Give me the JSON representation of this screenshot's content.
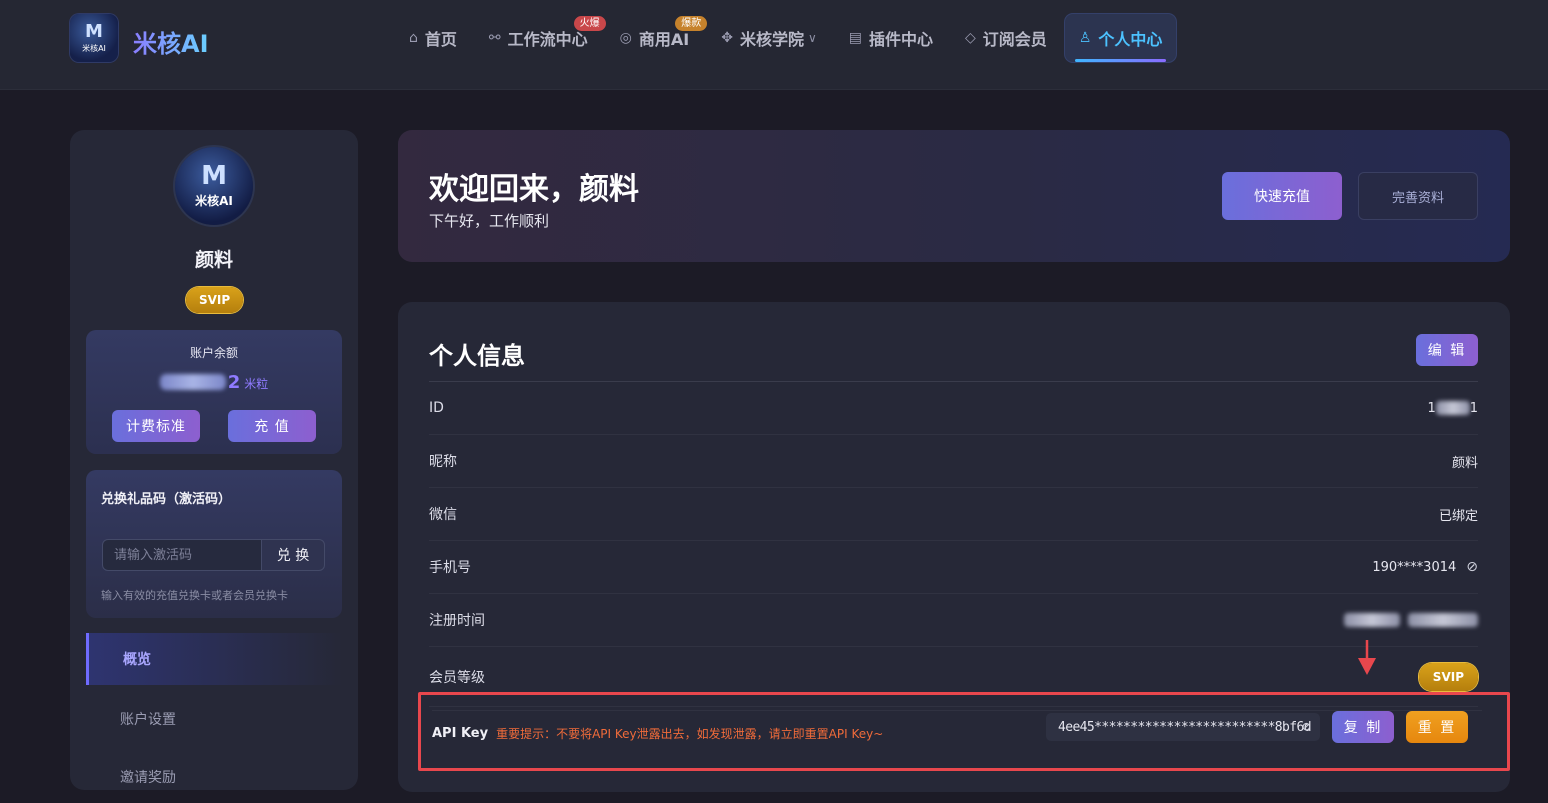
{
  "header": {
    "logo_text_m": "M",
    "logo_text_sub": "米核AI",
    "brand": "米核AI",
    "nav": [
      {
        "label": "首页",
        "icon": "⌂",
        "icon_name": "home-icon"
      },
      {
        "label": "工作流中心",
        "icon": "⚯",
        "icon_name": "workflow-icon",
        "badge": "火爆"
      },
      {
        "label": "商用AI",
        "icon": "◎",
        "icon_name": "target-icon",
        "badge": "爆款"
      },
      {
        "label": "米核学院",
        "icon": "✥",
        "icon_name": "academy-icon",
        "dropdown": "∨"
      },
      {
        "label": "插件中心",
        "icon": "▤",
        "icon_name": "plugin-icon"
      },
      {
        "label": "订阅会员",
        "icon": "◇",
        "icon_name": "diamond-icon"
      },
      {
        "label": "个人中心",
        "icon": "♙",
        "icon_name": "user-icon"
      }
    ]
  },
  "sidebar": {
    "avatar_m": "M",
    "avatar_sub": "米核AI",
    "username": "颜料",
    "level": "SVIP",
    "balance": {
      "title": "账户余额",
      "value_visible": "2",
      "unit": "米粒",
      "pricing_label": "计费标准",
      "recharge_label": "充 值"
    },
    "redeem": {
      "title": "兑换礼品码（激活码）",
      "placeholder": "请输入激活码",
      "button": "兑 换",
      "hint": "输入有效的充值兑换卡或者会员兑换卡"
    },
    "menu": [
      {
        "label": "概览",
        "active": true
      },
      {
        "label": "账户设置",
        "active": false
      },
      {
        "label": "邀请奖励",
        "active": false
      }
    ]
  },
  "welcome": {
    "title": "欢迎回来，颜料",
    "subtitle": "下午好，工作顺利",
    "quick_recharge": "快速充值",
    "complete_profile": "完善资料"
  },
  "info": {
    "title": "个人信息",
    "edit": "编 辑",
    "rows": [
      {
        "label": "ID",
        "value_prefix": "1",
        "value_suffix": "1"
      },
      {
        "label": "昵称",
        "value": "颜料"
      },
      {
        "label": "微信",
        "value": "已绑定"
      },
      {
        "label": "手机号",
        "value": "190****3014"
      },
      {
        "label": "注册时间"
      },
      {
        "label": "会员等级",
        "value": "SVIP"
      }
    ],
    "api": {
      "label": "API Key",
      "warning": "重要提示：不要将API Key泄露出去，如发现泄露，请立即重置API Key~",
      "key": "4ee45*************************8bf6d",
      "copy": "复 制",
      "reset": "重 置"
    }
  },
  "colors": {
    "accent": "#6f6bff",
    "active_nav": "#4cc2ff",
    "highlight_border": "#e8474d",
    "svip_gold": "#d9a21a",
    "warning_text": "#f06b3a"
  }
}
